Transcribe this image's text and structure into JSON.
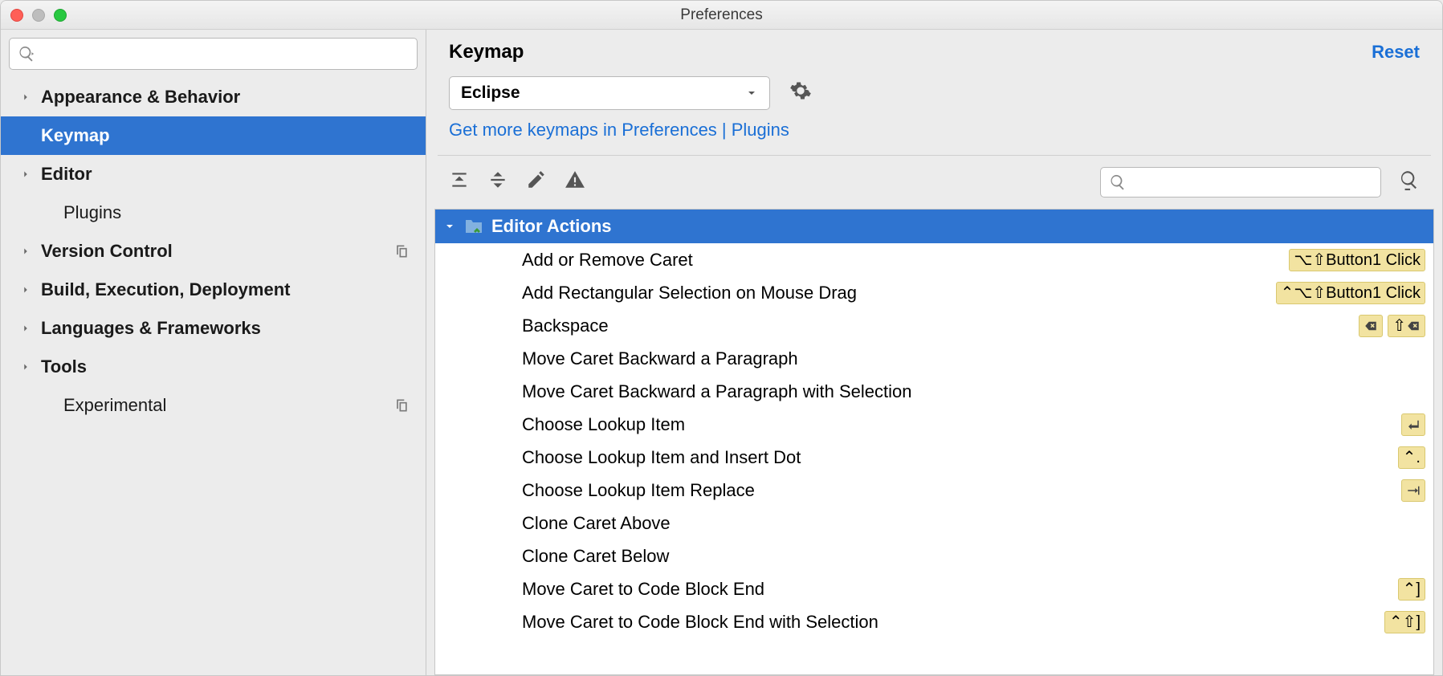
{
  "window": {
    "title": "Preferences"
  },
  "sidebar": {
    "items": [
      {
        "label": "Appearance & Behavior",
        "expandable": true
      },
      {
        "label": "Keymap",
        "selected": true
      },
      {
        "label": "Editor",
        "expandable": true
      },
      {
        "label": "Plugins"
      },
      {
        "label": "Version Control",
        "expandable": true,
        "tailIcon": true
      },
      {
        "label": "Build, Execution, Deployment",
        "expandable": true
      },
      {
        "label": "Languages & Frameworks",
        "expandable": true
      },
      {
        "label": "Tools",
        "expandable": true
      },
      {
        "label": "Experimental",
        "tailIcon": true
      }
    ]
  },
  "main": {
    "title": "Keymap",
    "reset": "Reset",
    "keymap_selected": "Eclipse",
    "plugins_link": "Get more keymaps in Preferences | Plugins",
    "group_header": "Editor Actions",
    "actions": [
      {
        "label": "Add or Remove Caret",
        "shortcuts": [
          "⌥⇧Button1 Click"
        ]
      },
      {
        "label": "Add Rectangular Selection on Mouse Drag",
        "shortcuts": [
          "⌃⌥⇧Button1 Click"
        ]
      },
      {
        "label": "Backspace",
        "shortcuts": [
          "icon:backspace",
          "⇧+icon:backspace"
        ]
      },
      {
        "label": "Move Caret Backward a Paragraph",
        "shortcuts": []
      },
      {
        "label": "Move Caret Backward a Paragraph with Selection",
        "shortcuts": []
      },
      {
        "label": "Choose Lookup Item",
        "shortcuts": [
          "icon:enter"
        ]
      },
      {
        "label": "Choose Lookup Item and Insert Dot",
        "shortcuts": [
          "⌃."
        ]
      },
      {
        "label": "Choose Lookup Item Replace",
        "shortcuts": [
          "icon:tab"
        ]
      },
      {
        "label": "Clone Caret Above",
        "shortcuts": []
      },
      {
        "label": "Clone Caret Below",
        "shortcuts": []
      },
      {
        "label": "Move Caret to Code Block End",
        "shortcuts": [
          "⌃]"
        ]
      },
      {
        "label": "Move Caret to Code Block End with Selection",
        "shortcuts": [
          "⌃⇧]"
        ]
      }
    ]
  }
}
